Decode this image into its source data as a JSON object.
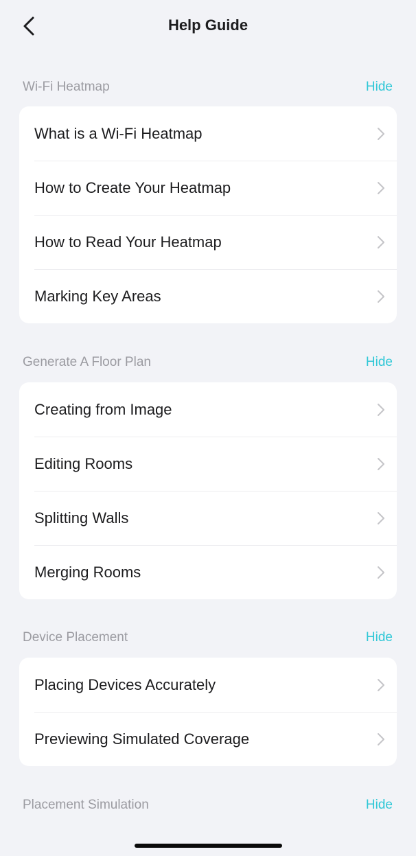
{
  "header": {
    "title": "Help Guide",
    "back_icon": "chevron-left-icon"
  },
  "sections": [
    {
      "title": "Wi-Fi Heatmap",
      "hide_label": "Hide",
      "items": [
        {
          "label": "What is a Wi-Fi Heatmap"
        },
        {
          "label": "How to Create Your Heatmap"
        },
        {
          "label": "How to Read Your Heatmap"
        },
        {
          "label": "Marking Key Areas"
        }
      ]
    },
    {
      "title": "Generate A Floor Plan",
      "hide_label": "Hide",
      "items": [
        {
          "label": "Creating from Image"
        },
        {
          "label": "Editing Rooms"
        },
        {
          "label": "Splitting Walls"
        },
        {
          "label": "Merging Rooms"
        }
      ]
    },
    {
      "title": "Device Placement",
      "hide_label": "Hide",
      "items": [
        {
          "label": "Placing Devices Accurately"
        },
        {
          "label": "Previewing Simulated Coverage"
        }
      ]
    },
    {
      "title": "Placement Simulation",
      "hide_label": "Hide",
      "items": []
    }
  ],
  "colors": {
    "background": "#f2f3f7",
    "card": "#ffffff",
    "accent": "#2ec7d6",
    "section_title": "#9b9ba1",
    "text": "#1c1c1e",
    "chevron": "#c4c4c8"
  }
}
